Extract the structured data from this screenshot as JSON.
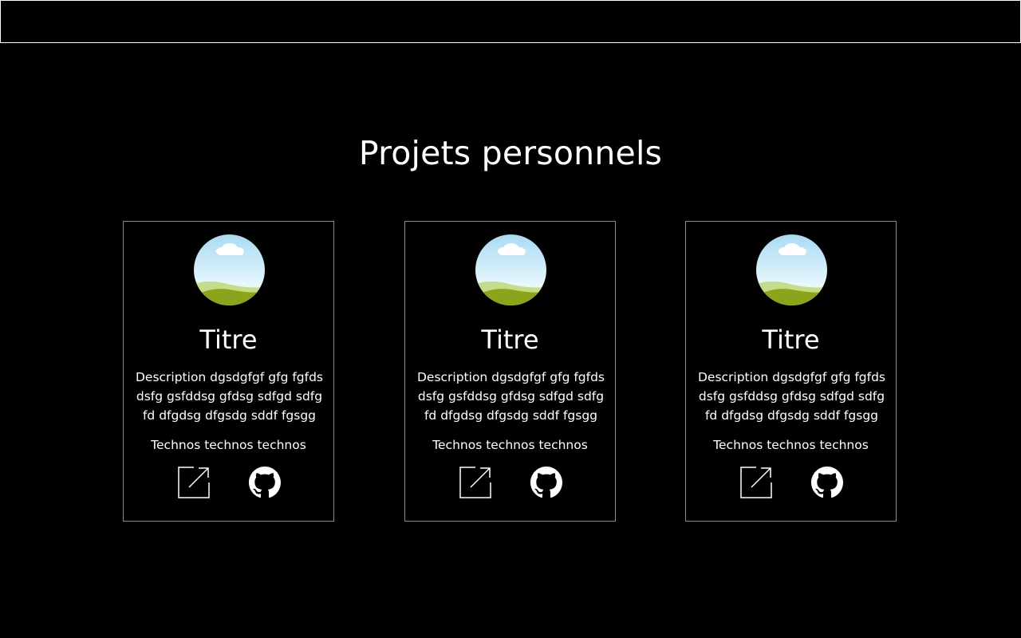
{
  "header": {
    "bar": ""
  },
  "section": {
    "title": "Projets personnels"
  },
  "projects": [
    {
      "title": "Titre",
      "description": "Description dgsdgfgf gfg fgfds dsfg gsfddsg gfdsg sdfgd sdfg fd dfgdsg dfgsdg sddf fgsgg",
      "technos": "Technos technos technos",
      "icons": {
        "external": "external-link-icon",
        "github": "github-icon"
      }
    },
    {
      "title": "Titre",
      "description": "Description dgsdgfgf gfg fgfds dsfg gsfddsg gfdsg sdfgd sdfg fd dfgdsg dfgsdg sddf fgsgg",
      "technos": "Technos technos technos",
      "icons": {
        "external": "external-link-icon",
        "github": "github-icon"
      }
    },
    {
      "title": "Titre",
      "description": "Description dgsdgfgf gfg fgfds dsfg gsfddsg gfdsg sdfgd sdfg fd dfgdsg dfgsdg sddf fgsgg",
      "technos": "Technos technos technos",
      "icons": {
        "external": "external-link-icon",
        "github": "github-icon"
      }
    }
  ],
  "colors": {
    "background": "#000000",
    "text": "#ffffff",
    "card_border": "#8a8a8a",
    "sky": "#cfeefb",
    "hill_light": "#c5dc8a",
    "hill_dark": "#8aa51c"
  }
}
